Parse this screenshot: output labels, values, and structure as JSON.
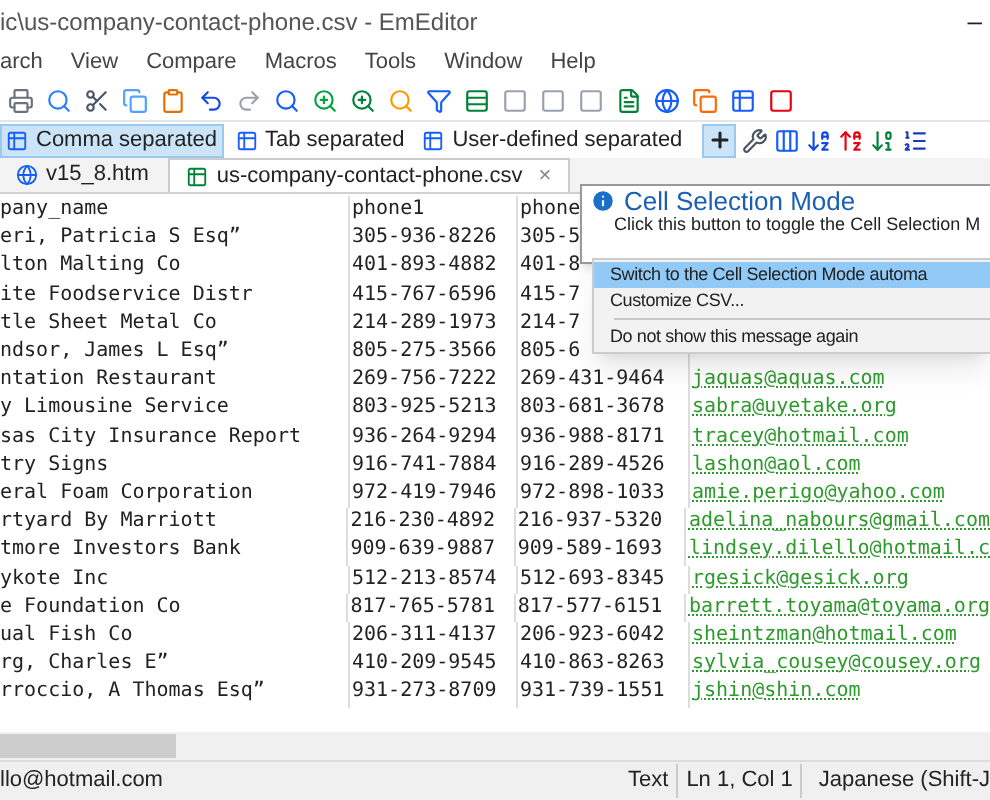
{
  "window": {
    "title": "ic\\us-company-contact-phone.csv - EmEditor",
    "minimize": "–"
  },
  "menu_bar": [
    "arch",
    "View",
    "Compare",
    "Macros",
    "Tools",
    "Window",
    "Help"
  ],
  "csv_toolbar": [
    {
      "label": "Comma separated",
      "selected": true
    },
    {
      "label": "Tab separated",
      "selected": false
    },
    {
      "label": "User-defined separated",
      "selected": false
    }
  ],
  "cell_selection_button": {
    "selected": true
  },
  "tabs": [
    {
      "label": "v15_8.htm",
      "kind": "html",
      "selected": false
    },
    {
      "label": "us-company-contact-phone.csv",
      "kind": "csv",
      "selected": true,
      "close": "×"
    }
  ],
  "table": {
    "columns": [
      "pany_name",
      "phone1",
      "phone"
    ],
    "rows": [
      [
        "eri, Patricia S Esq”",
        "305-936-8226",
        "305-5",
        ""
      ],
      [
        "lton Malting Co",
        "401-893-4882",
        "401-8",
        ""
      ],
      [
        "ite Foodservice Distr",
        "415-767-6596",
        "415-7",
        ""
      ],
      [
        "tle Sheet Metal Co",
        "214-289-1973",
        "214-7",
        ""
      ],
      [
        "ndsor, James L Esq”",
        "805-275-3566",
        "805-6",
        ""
      ],
      [
        "ntation Restaurant",
        "269-756-7222",
        "269-431-9464",
        "jaquas@aquas.com"
      ],
      [
        "y Limousine Service",
        "803-925-5213",
        "803-681-3678",
        "sabra@uyetake.org"
      ],
      [
        "sas City Insurance Report",
        "936-264-9294",
        "936-988-8171",
        "tracey@hotmail.com"
      ],
      [
        "try Signs",
        "916-741-7884",
        "916-289-4526",
        "lashon@aol.com"
      ],
      [
        "eral Foam Corporation",
        "972-419-7946",
        "972-898-1033",
        "amie.perigo@yahoo.com"
      ],
      [
        "rtyard By Marriott",
        "216-230-4892",
        "216-937-5320",
        "adelina_nabours@gmail.com"
      ],
      [
        "tmore Investors Bank",
        "909-639-9887",
        "909-589-1693",
        "lindsey.dilello@hotmail.c"
      ],
      [
        "ykote Inc",
        "512-213-8574",
        "512-693-8345",
        "rgesick@gesick.org"
      ],
      [
        "e Foundation Co",
        "817-765-5781",
        "817-577-6151",
        "barrett.toyama@toyama.org"
      ],
      [
        "ual Fish Co",
        "206-311-4137",
        "206-923-6042",
        "sheintzman@hotmail.com"
      ],
      [
        "rg, Charles E”",
        "410-209-9545",
        "410-863-8263",
        "sylvia_cousey@cousey.org"
      ],
      [
        "rroccio, A Thomas Esq”",
        "931-273-8709",
        "931-739-1551",
        "jshin@shin.com"
      ]
    ]
  },
  "balloon": {
    "title": "Cell Selection Mode",
    "text": "Click this button to toggle the Cell Selection M"
  },
  "context_menu": [
    {
      "label": "Switch to the Cell Selection Mode automa",
      "selected": true
    },
    {
      "label": "Customize CSV...",
      "selected": false
    },
    {
      "label": "Do not show this message again",
      "selected": false,
      "separator_before": true
    }
  ],
  "status_bar": {
    "left": "llo@hotmail.com",
    "mode": "Text",
    "position": "Ln 1, Col 1",
    "encoding": "Japanese (Shift-J"
  }
}
